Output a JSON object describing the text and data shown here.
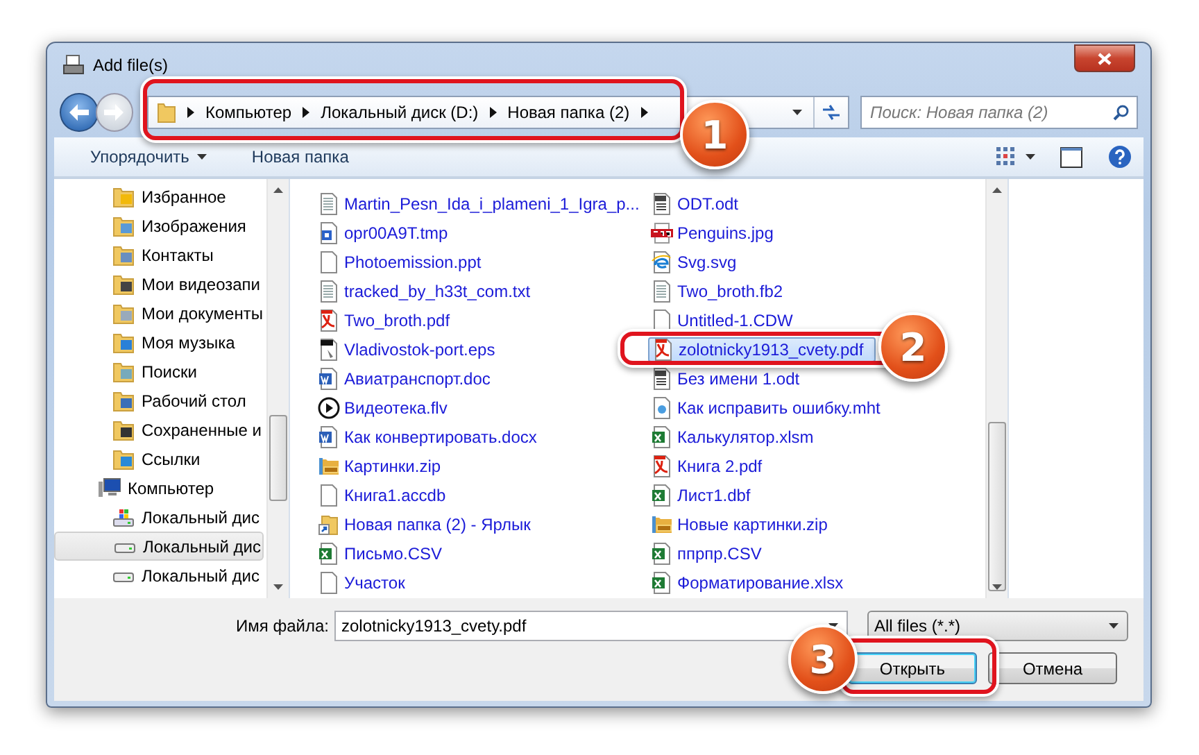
{
  "window": {
    "title": "Add file(s)"
  },
  "address": {
    "path": [
      "Компьютер",
      "Локальный диск (D:)",
      "Новая папка (2)"
    ]
  },
  "search": {
    "placeholder": "Поиск: Новая папка (2)"
  },
  "toolbar": {
    "organize": "Упорядочить",
    "new_folder": "Новая папка"
  },
  "sidebar": {
    "items": [
      {
        "label": "Избранное",
        "kind": "favorites",
        "selected": false
      },
      {
        "label": "Изображения",
        "kind": "pictures",
        "selected": false
      },
      {
        "label": "Контакты",
        "kind": "contacts",
        "selected": false
      },
      {
        "label": "Мои видеозапи",
        "kind": "videos",
        "selected": false
      },
      {
        "label": "Мои документы",
        "kind": "documents",
        "selected": false
      },
      {
        "label": "Моя музыка",
        "kind": "music",
        "selected": false
      },
      {
        "label": "Поиски",
        "kind": "searches",
        "selected": false
      },
      {
        "label": "Рабочий стол",
        "kind": "desktop",
        "selected": false
      },
      {
        "label": "Сохраненные и",
        "kind": "games",
        "selected": false
      },
      {
        "label": "Ссылки",
        "kind": "links",
        "selected": false
      },
      {
        "label": "Компьютер",
        "kind": "computer",
        "selected": false,
        "children": [
          {
            "label": "Локальный дис",
            "kind": "system-disk",
            "selected": false
          },
          {
            "label": "Локальный дис",
            "kind": "disk",
            "selected": true
          },
          {
            "label": "Локальный дис",
            "kind": "disk",
            "selected": false
          }
        ]
      }
    ]
  },
  "files": [
    {
      "name": "Martin_Pesn_Ida_i_plameni_1_Igra_p...",
      "kind": "text",
      "selected": false
    },
    {
      "name": "opr00A9T.tmp",
      "kind": "tmp",
      "selected": false
    },
    {
      "name": "Photoemission.ppt",
      "kind": "blank",
      "selected": false
    },
    {
      "name": "tracked_by_h33t_com.txt",
      "kind": "text",
      "selected": false
    },
    {
      "name": "Two_broth.pdf",
      "kind": "pdf",
      "selected": false
    },
    {
      "name": "Vladivostok-port.eps",
      "kind": "eps",
      "selected": false
    },
    {
      "name": "Авиатранспорт.doc",
      "kind": "word",
      "selected": false
    },
    {
      "name": "Видеотека.flv",
      "kind": "video",
      "selected": false
    },
    {
      "name": "Как конвертировать.docx",
      "kind": "word",
      "selected": false
    },
    {
      "name": "Картинки.zip",
      "kind": "zip",
      "selected": false
    },
    {
      "name": "Книга1.accdb",
      "kind": "blank",
      "selected": false
    },
    {
      "name": "Новая папка (2) - Ярлык",
      "kind": "shortcut",
      "selected": false
    },
    {
      "name": "Письмо.CSV",
      "kind": "excel",
      "selected": false
    },
    {
      "name": "Участок",
      "kind": "blank",
      "selected": false
    },
    {
      "name": "ODT.odt",
      "kind": "odt",
      "selected": false
    },
    {
      "name": "Penguins.jpg",
      "kind": "jpg",
      "selected": false
    },
    {
      "name": "Svg.svg",
      "kind": "web",
      "selected": false
    },
    {
      "name": "Two_broth.fb2",
      "kind": "text",
      "selected": false
    },
    {
      "name": "Untitled-1.CDW",
      "kind": "blank",
      "selected": false
    },
    {
      "name": "zolotnicky1913_cvety.pdf",
      "kind": "pdf",
      "selected": true
    },
    {
      "name": "Без имени 1.odt",
      "kind": "odt",
      "selected": false
    },
    {
      "name": "Как исправить ошибку.mht",
      "kind": "mht",
      "selected": false
    },
    {
      "name": "Калькулятор.xlsm",
      "kind": "excel",
      "selected": false
    },
    {
      "name": "Книга 2.pdf",
      "kind": "pdf",
      "selected": false
    },
    {
      "name": "Лист1.dbf",
      "kind": "excel",
      "selected": false
    },
    {
      "name": "Новые картинки.zip",
      "kind": "zip",
      "selected": false
    },
    {
      "name": "ппрпр.CSV",
      "kind": "excel",
      "selected": false
    },
    {
      "name": "Форматирование.xlsx",
      "kind": "excel",
      "selected": false
    }
  ],
  "footer": {
    "filename_label": "Имя файла:",
    "filename": "zolotnicky1913_cvety.pdf",
    "filter": "All files (*.*)",
    "buttons": [
      {
        "label": "Открыть",
        "default": true
      },
      {
        "label": "Отмена",
        "default": false
      }
    ]
  },
  "callouts": [
    {
      "number": "1"
    },
    {
      "number": "2"
    },
    {
      "number": "3"
    }
  ]
}
